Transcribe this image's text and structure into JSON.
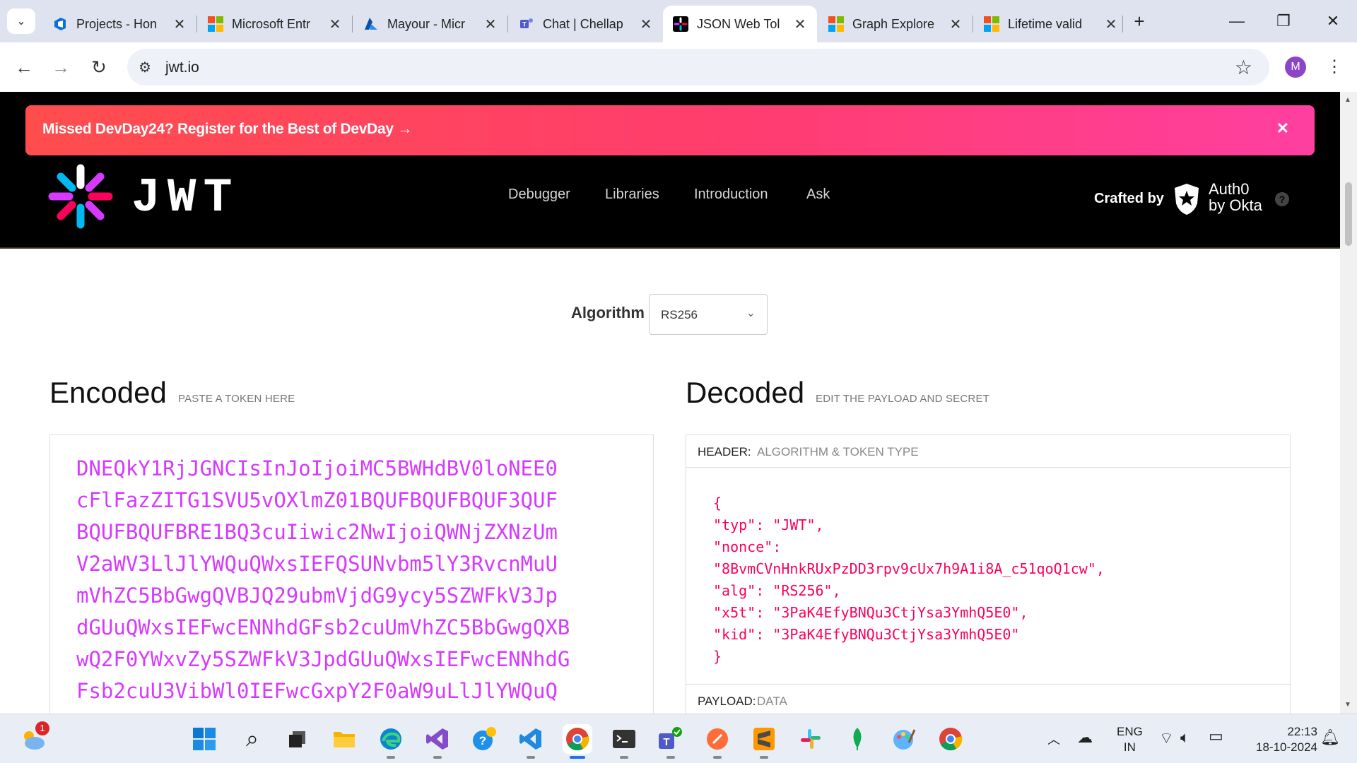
{
  "browser": {
    "tabs": [
      {
        "title": "Projects - Hon",
        "icon": "devops-icon"
      },
      {
        "title": "Microsoft Entr",
        "icon": "microsoft-logo-icon"
      },
      {
        "title": "Mayour - Micr",
        "icon": "azure-icon"
      },
      {
        "title": "Chat | Chellap",
        "icon": "teams-icon"
      },
      {
        "title": "JSON Web Tol",
        "icon": "jwt-icon"
      },
      {
        "title": "Graph Explore",
        "icon": "microsoft-logo-icon"
      },
      {
        "title": "Lifetime valid",
        "icon": "microsoft-logo-icon"
      }
    ],
    "active_tab_index": 4,
    "url": "jwt.io",
    "profile_initial": "M"
  },
  "page": {
    "banner_text": "Missed DevDay24? Register for the Best of DevDay →",
    "logo_text": "JWT",
    "nav": [
      "Debugger",
      "Libraries",
      "Introduction",
      "Ask"
    ],
    "crafted_by": "Crafted by",
    "auth0_line1": "Auth0",
    "auth0_line2": "by Okta",
    "help": "?",
    "algorithm_label": "Algorithm",
    "algorithm_value": "RS256",
    "encoded_title": "Encoded",
    "encoded_hint": "PASTE A TOKEN HERE",
    "decoded_title": "Decoded",
    "decoded_hint": "EDIT THE PAYLOAD AND SECRET",
    "encoded_lines": [
      "DNEQkY1RjJGNCIsInJoIjoiMC5BWHdBV0loNEE0",
      "cFlFazZITG1SVU5vOXlmZ01BQUFBQUFBQUF3QUF",
      "BQUFBQUFBRE1BQ3cuIiwic2NwIjoiQWNjZXNzUm",
      "V2aWV3LlJlYWQuQWxsIEFQSUNvbm5lY3RvcnMuU",
      "mVhZC5BbGwgQVBJQ29ubmVjdG9ycy5SZWFkV3Jp",
      "dGUuQWxsIEFwcENNhdGFsb2cuUmVhZC5BbGwgQXB",
      "wQ2F0YWxvZy5SZWFkV3JpdGUuQWxsIEFwcENNhdG",
      "Fsb2cuU3VibWl0IEFwcGxpY2F0aW9uLlJlYWQuQ"
    ],
    "header_label": "HEADER:",
    "header_sub": "ALGORITHM & TOKEN TYPE",
    "header_json": [
      "{",
      "  \"typ\": \"JWT\",",
      "  \"nonce\":",
      "\"8BvmCVnHnkRUxPzDD3rpv9cUx7h9A1i8A_c51qoQ1cw\",",
      "  \"alg\": \"RS256\",",
      "  \"x5t\": \"3PaK4EfyBNQu3CtjYsa3YmhQ5E0\",",
      "  \"kid\": \"3PaK4EfyBNQu3CtjYsa3YmhQ5E0\"",
      "}"
    ],
    "payload_label": "PAYLOAD:",
    "payload_sub": "DATA"
  },
  "taskbar": {
    "weather_badge": "1",
    "lang_line1": "ENG",
    "lang_line2": "IN",
    "time": "22:13",
    "date": "18-10-2024"
  },
  "colors": {
    "token_magenta": "#d63aff",
    "json_red": "#fb015b",
    "banner_start": "#ff4d4d",
    "banner_end": "#ff3fa0"
  }
}
